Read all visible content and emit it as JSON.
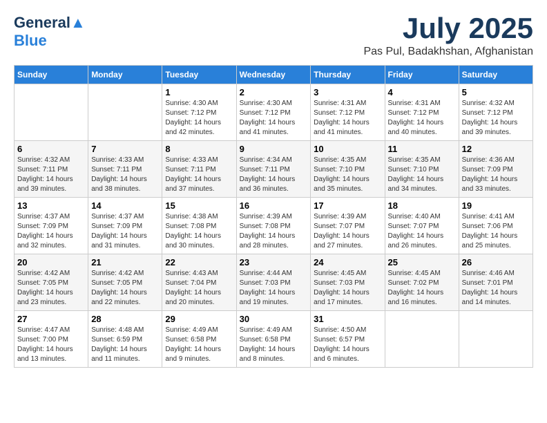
{
  "header": {
    "logo_line1": "General",
    "logo_line2": "Blue",
    "month_title": "July 2025",
    "subtitle": "Pas Pul, Badakhshan, Afghanistan"
  },
  "weekdays": [
    "Sunday",
    "Monday",
    "Tuesday",
    "Wednesday",
    "Thursday",
    "Friday",
    "Saturday"
  ],
  "weeks": [
    [
      {
        "day": "",
        "sunrise": "",
        "sunset": "",
        "daylight": ""
      },
      {
        "day": "",
        "sunrise": "",
        "sunset": "",
        "daylight": ""
      },
      {
        "day": "1",
        "sunrise": "Sunrise: 4:30 AM",
        "sunset": "Sunset: 7:12 PM",
        "daylight": "Daylight: 14 hours and 42 minutes."
      },
      {
        "day": "2",
        "sunrise": "Sunrise: 4:30 AM",
        "sunset": "Sunset: 7:12 PM",
        "daylight": "Daylight: 14 hours and 41 minutes."
      },
      {
        "day": "3",
        "sunrise": "Sunrise: 4:31 AM",
        "sunset": "Sunset: 7:12 PM",
        "daylight": "Daylight: 14 hours and 41 minutes."
      },
      {
        "day": "4",
        "sunrise": "Sunrise: 4:31 AM",
        "sunset": "Sunset: 7:12 PM",
        "daylight": "Daylight: 14 hours and 40 minutes."
      },
      {
        "day": "5",
        "sunrise": "Sunrise: 4:32 AM",
        "sunset": "Sunset: 7:12 PM",
        "daylight": "Daylight: 14 hours and 39 minutes."
      }
    ],
    [
      {
        "day": "6",
        "sunrise": "Sunrise: 4:32 AM",
        "sunset": "Sunset: 7:11 PM",
        "daylight": "Daylight: 14 hours and 39 minutes."
      },
      {
        "day": "7",
        "sunrise": "Sunrise: 4:33 AM",
        "sunset": "Sunset: 7:11 PM",
        "daylight": "Daylight: 14 hours and 38 minutes."
      },
      {
        "day": "8",
        "sunrise": "Sunrise: 4:33 AM",
        "sunset": "Sunset: 7:11 PM",
        "daylight": "Daylight: 14 hours and 37 minutes."
      },
      {
        "day": "9",
        "sunrise": "Sunrise: 4:34 AM",
        "sunset": "Sunset: 7:11 PM",
        "daylight": "Daylight: 14 hours and 36 minutes."
      },
      {
        "day": "10",
        "sunrise": "Sunrise: 4:35 AM",
        "sunset": "Sunset: 7:10 PM",
        "daylight": "Daylight: 14 hours and 35 minutes."
      },
      {
        "day": "11",
        "sunrise": "Sunrise: 4:35 AM",
        "sunset": "Sunset: 7:10 PM",
        "daylight": "Daylight: 14 hours and 34 minutes."
      },
      {
        "day": "12",
        "sunrise": "Sunrise: 4:36 AM",
        "sunset": "Sunset: 7:09 PM",
        "daylight": "Daylight: 14 hours and 33 minutes."
      }
    ],
    [
      {
        "day": "13",
        "sunrise": "Sunrise: 4:37 AM",
        "sunset": "Sunset: 7:09 PM",
        "daylight": "Daylight: 14 hours and 32 minutes."
      },
      {
        "day": "14",
        "sunrise": "Sunrise: 4:37 AM",
        "sunset": "Sunset: 7:09 PM",
        "daylight": "Daylight: 14 hours and 31 minutes."
      },
      {
        "day": "15",
        "sunrise": "Sunrise: 4:38 AM",
        "sunset": "Sunset: 7:08 PM",
        "daylight": "Daylight: 14 hours and 30 minutes."
      },
      {
        "day": "16",
        "sunrise": "Sunrise: 4:39 AM",
        "sunset": "Sunset: 7:08 PM",
        "daylight": "Daylight: 14 hours and 28 minutes."
      },
      {
        "day": "17",
        "sunrise": "Sunrise: 4:39 AM",
        "sunset": "Sunset: 7:07 PM",
        "daylight": "Daylight: 14 hours and 27 minutes."
      },
      {
        "day": "18",
        "sunrise": "Sunrise: 4:40 AM",
        "sunset": "Sunset: 7:07 PM",
        "daylight": "Daylight: 14 hours and 26 minutes."
      },
      {
        "day": "19",
        "sunrise": "Sunrise: 4:41 AM",
        "sunset": "Sunset: 7:06 PM",
        "daylight": "Daylight: 14 hours and 25 minutes."
      }
    ],
    [
      {
        "day": "20",
        "sunrise": "Sunrise: 4:42 AM",
        "sunset": "Sunset: 7:05 PM",
        "daylight": "Daylight: 14 hours and 23 minutes."
      },
      {
        "day": "21",
        "sunrise": "Sunrise: 4:42 AM",
        "sunset": "Sunset: 7:05 PM",
        "daylight": "Daylight: 14 hours and 22 minutes."
      },
      {
        "day": "22",
        "sunrise": "Sunrise: 4:43 AM",
        "sunset": "Sunset: 7:04 PM",
        "daylight": "Daylight: 14 hours and 20 minutes."
      },
      {
        "day": "23",
        "sunrise": "Sunrise: 4:44 AM",
        "sunset": "Sunset: 7:03 PM",
        "daylight": "Daylight: 14 hours and 19 minutes."
      },
      {
        "day": "24",
        "sunrise": "Sunrise: 4:45 AM",
        "sunset": "Sunset: 7:03 PM",
        "daylight": "Daylight: 14 hours and 17 minutes."
      },
      {
        "day": "25",
        "sunrise": "Sunrise: 4:45 AM",
        "sunset": "Sunset: 7:02 PM",
        "daylight": "Daylight: 14 hours and 16 minutes."
      },
      {
        "day": "26",
        "sunrise": "Sunrise: 4:46 AM",
        "sunset": "Sunset: 7:01 PM",
        "daylight": "Daylight: 14 hours and 14 minutes."
      }
    ],
    [
      {
        "day": "27",
        "sunrise": "Sunrise: 4:47 AM",
        "sunset": "Sunset: 7:00 PM",
        "daylight": "Daylight: 14 hours and 13 minutes."
      },
      {
        "day": "28",
        "sunrise": "Sunrise: 4:48 AM",
        "sunset": "Sunset: 6:59 PM",
        "daylight": "Daylight: 14 hours and 11 minutes."
      },
      {
        "day": "29",
        "sunrise": "Sunrise: 4:49 AM",
        "sunset": "Sunset: 6:58 PM",
        "daylight": "Daylight: 14 hours and 9 minutes."
      },
      {
        "day": "30",
        "sunrise": "Sunrise: 4:49 AM",
        "sunset": "Sunset: 6:58 PM",
        "daylight": "Daylight: 14 hours and 8 minutes."
      },
      {
        "day": "31",
        "sunrise": "Sunrise: 4:50 AM",
        "sunset": "Sunset: 6:57 PM",
        "daylight": "Daylight: 14 hours and 6 minutes."
      },
      {
        "day": "",
        "sunrise": "",
        "sunset": "",
        "daylight": ""
      },
      {
        "day": "",
        "sunrise": "",
        "sunset": "",
        "daylight": ""
      }
    ]
  ]
}
